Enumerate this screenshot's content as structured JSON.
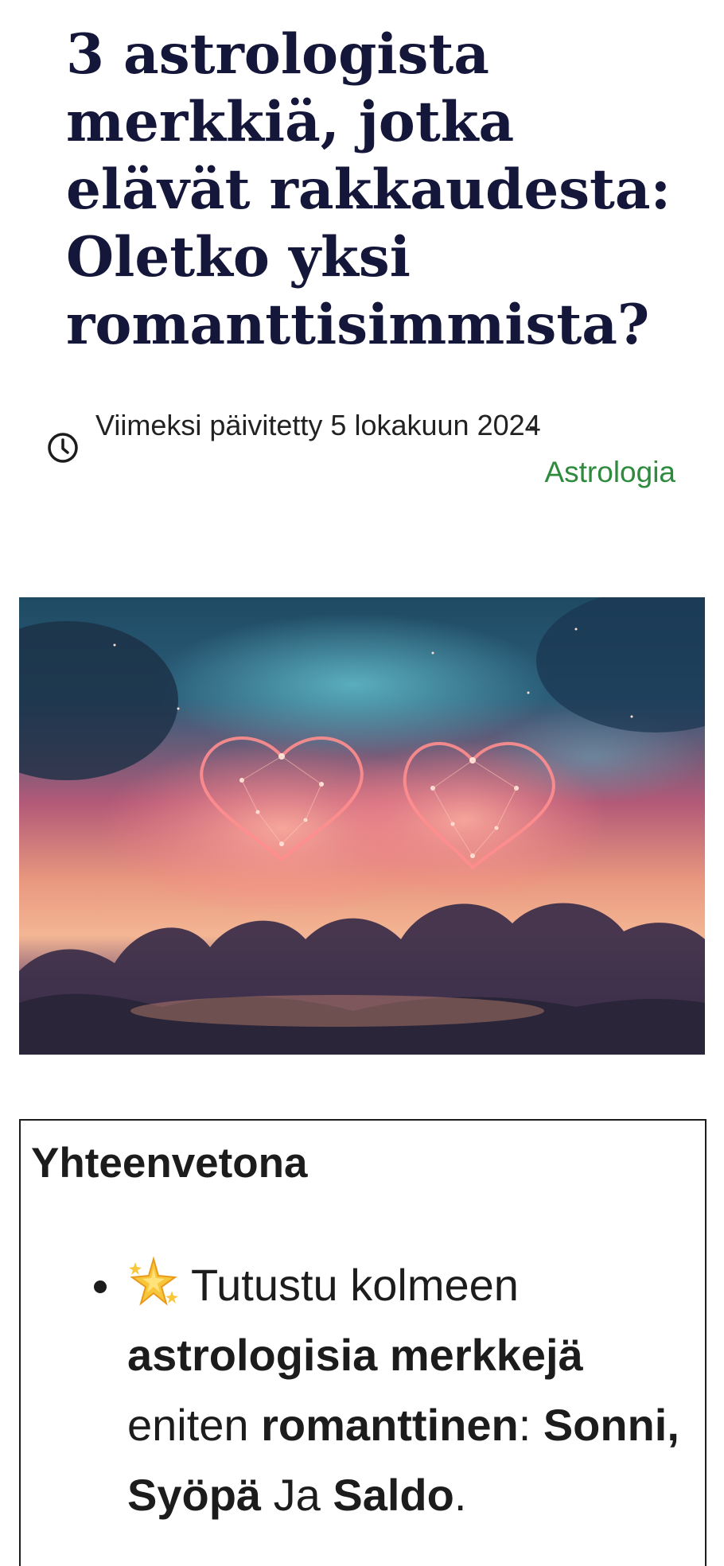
{
  "article": {
    "title": "3 astrologista merkkiä, jotka elävät rakkaudesta: Oletko yksi romanttisimmista?",
    "updated_text": "Viimeksi päivitetty 5 lokakuun 2024",
    "separator": "-",
    "category": "Astrologia",
    "category_color": "#2e8b3e",
    "clock_icon": "clock-icon",
    "hero_image_icon": "constellation-hearts-sky-image"
  },
  "summary": {
    "title": "Yhteenvetona",
    "items": [
      {
        "icon": "sparkle-icon",
        "parts": {
          "p1": "Tutustu kolmeen",
          "p2": "astrologisia merkkejä",
          "p3": "eniten",
          "p4": "romanttinen",
          "p5": ":",
          "p6": "Sonni,",
          "p7": "Syöpä",
          "p8": "Ja",
          "p9": "Saldo",
          "p10": "."
        }
      }
    ]
  },
  "colors": {
    "title": "#14163a",
    "text": "#1c1c1c",
    "accent": "#2e8b3e"
  }
}
